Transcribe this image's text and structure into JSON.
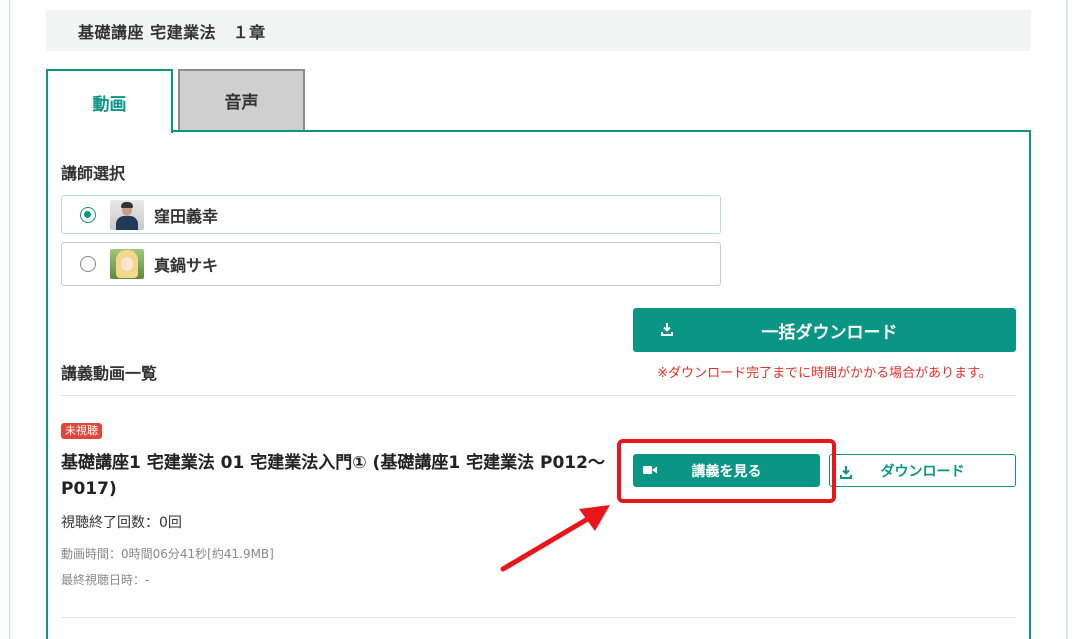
{
  "course": {
    "title": "基礎講座 宅建業法　１章"
  },
  "tabs": [
    {
      "label": "動画",
      "active": true
    },
    {
      "label": "音声",
      "active": false
    }
  ],
  "teacher_section": {
    "label": "講師選択",
    "options": [
      {
        "name": "窪田義幸",
        "selected": true
      },
      {
        "name": "真鍋サキ",
        "selected": false
      }
    ]
  },
  "bulk_download": {
    "label": "一括ダウンロード",
    "note": "※ダウンロード完了までに時間がかかる場合があります。"
  },
  "lecture_list": {
    "label": "講義動画一覧",
    "items": [
      {
        "badge": "未視聴",
        "title": "基礎講座1 宅建業法 01 宅建業法入門① (基礎講座1 宅建業法 P012～P017)",
        "view_count": "視聴終了回数：0回",
        "duration": "動画時間：0時間06分41秒[約41.9MB]",
        "last_viewed": "最終視聴日時：-",
        "watch_label": "講義を見る",
        "download_label": "ダウンロード"
      }
    ]
  },
  "colors": {
    "accent": "#0a9585",
    "badge": "#e0463b",
    "note": "#e0312d",
    "highlight": "#e8161a"
  }
}
